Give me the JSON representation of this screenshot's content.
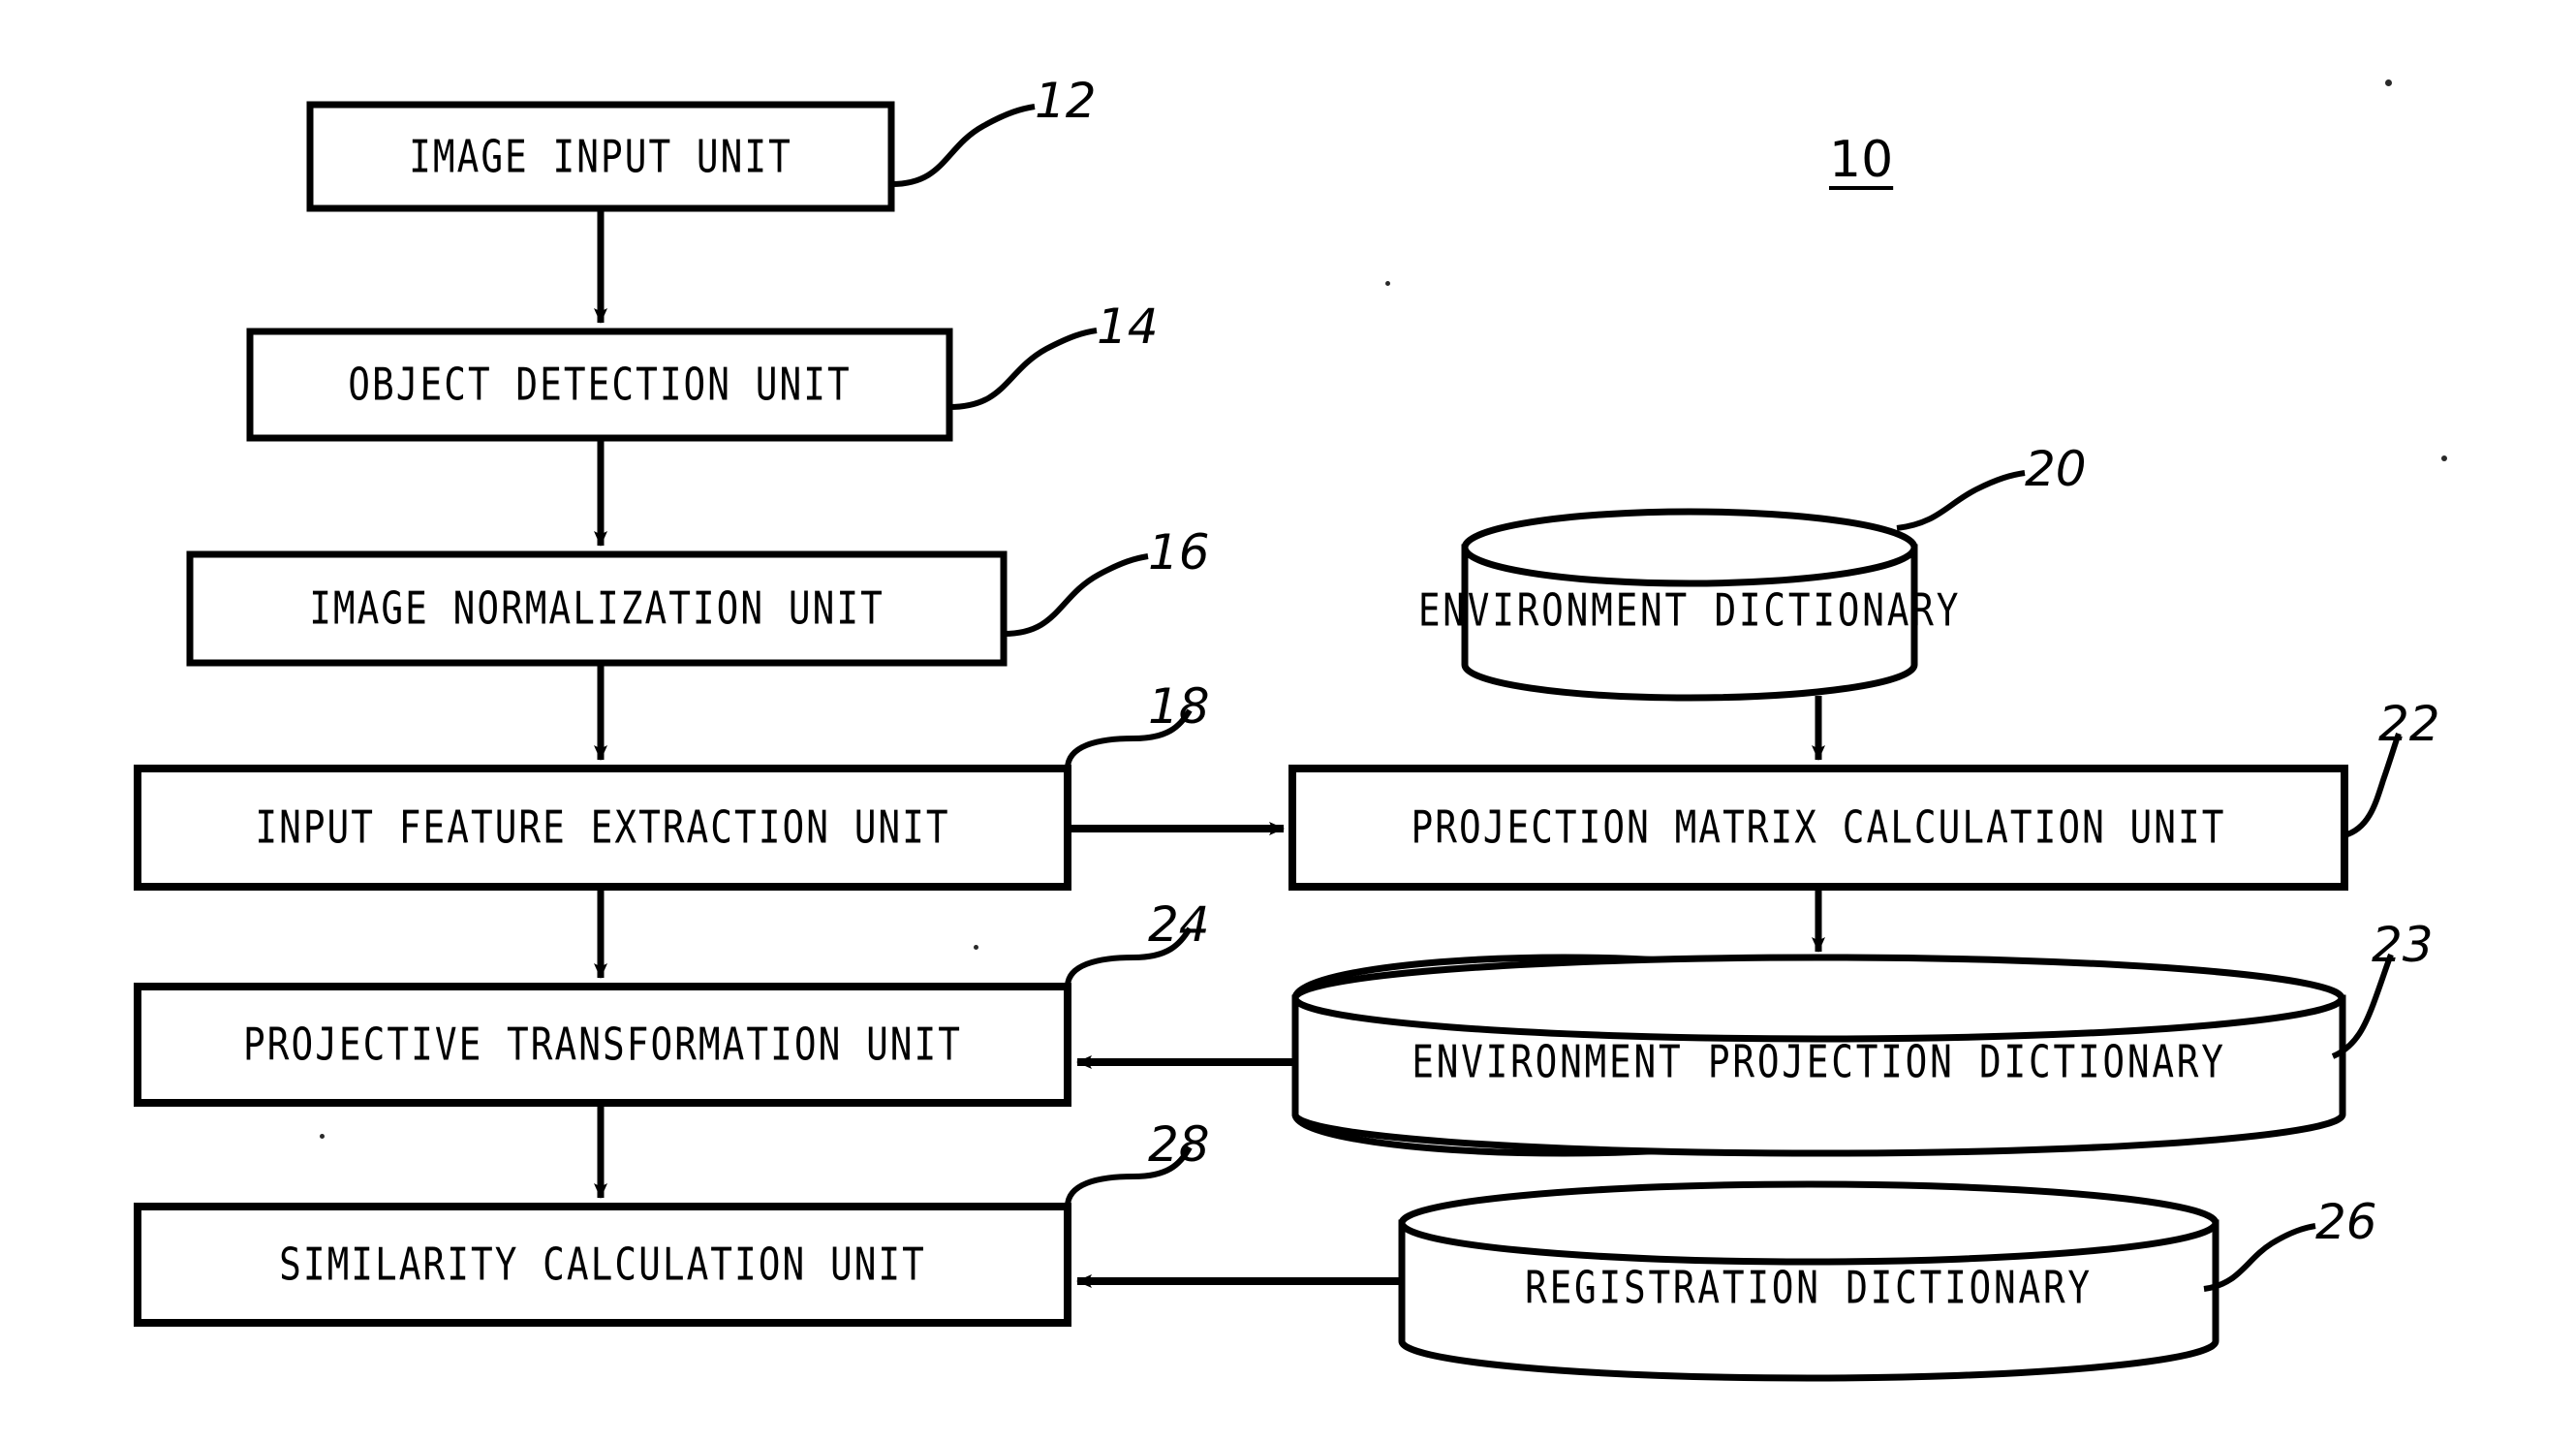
{
  "figure": {
    "system_number": "10",
    "type": "patent-block-diagram"
  },
  "nodes": [
    {
      "id": "n12",
      "ref": "12",
      "label": "IMAGE INPUT UNIT",
      "shape": "rect"
    },
    {
      "id": "n14",
      "ref": "14",
      "label": "OBJECT DETECTION UNIT",
      "shape": "rect"
    },
    {
      "id": "n16",
      "ref": "16",
      "label": "IMAGE NORMALIZATION UNIT",
      "shape": "rect"
    },
    {
      "id": "n18",
      "ref": "18",
      "label": "INPUT FEATURE EXTRACTION UNIT",
      "shape": "rect"
    },
    {
      "id": "n24",
      "ref": "24",
      "label": "PROJECTIVE TRANSFORMATION UNIT",
      "shape": "rect"
    },
    {
      "id": "n28",
      "ref": "28",
      "label": "SIMILARITY CALCULATION UNIT",
      "shape": "rect"
    },
    {
      "id": "n20",
      "ref": "20",
      "label": "ENVIRONMENT DICTIONARY",
      "shape": "cylinder"
    },
    {
      "id": "n22",
      "ref": "22",
      "label": "PROJECTION MATRIX CALCULATION UNIT",
      "shape": "rect"
    },
    {
      "id": "n23",
      "ref": "23",
      "label": "ENVIRONMENT PROJECTION DICTIONARY",
      "shape": "cylinder"
    },
    {
      "id": "n26",
      "ref": "26",
      "label": "REGISTRATION DICTIONARY",
      "shape": "cylinder"
    }
  ],
  "edges": [
    {
      "from": "n12",
      "to": "n14",
      "direction": "down"
    },
    {
      "from": "n14",
      "to": "n16",
      "direction": "down"
    },
    {
      "from": "n16",
      "to": "n18",
      "direction": "down"
    },
    {
      "from": "n18",
      "to": "n24",
      "direction": "down"
    },
    {
      "from": "n24",
      "to": "n28",
      "direction": "down"
    },
    {
      "from": "n18",
      "to": "n22",
      "direction": "right"
    },
    {
      "from": "n20",
      "to": "n22",
      "direction": "down"
    },
    {
      "from": "n22",
      "to": "n23",
      "direction": "down"
    },
    {
      "from": "n23",
      "to": "n24",
      "direction": "left"
    },
    {
      "from": "n26",
      "to": "n28",
      "direction": "left"
    }
  ]
}
